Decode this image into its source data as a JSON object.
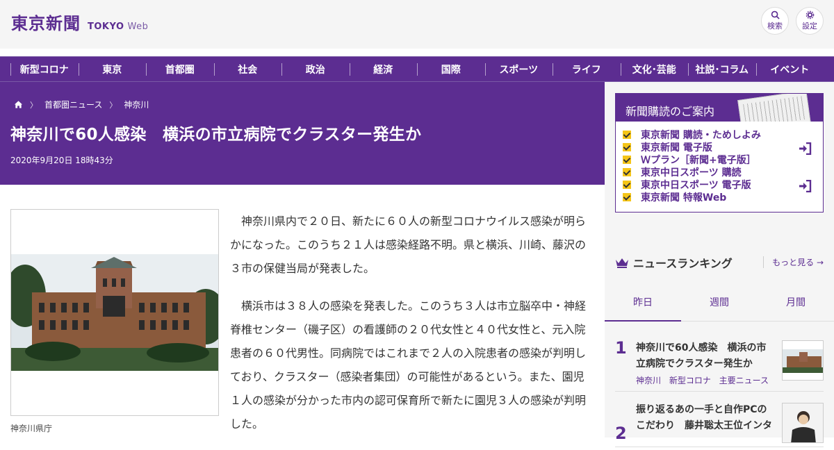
{
  "header": {
    "logo_kanji": "東京新聞",
    "logo_en": "TOKYO",
    "logo_web": "Web",
    "search_label": "検索",
    "settings_label": "設定"
  },
  "nav": [
    "新型コロナ",
    "東京",
    "首都圏",
    "社会",
    "政治",
    "経済",
    "国際",
    "スポーツ",
    "ライフ",
    "文化･芸能",
    "社説･コラム",
    "イベント"
  ],
  "article": {
    "breadcrumb": [
      "首都圏ニュース",
      "神奈川"
    ],
    "title": "神奈川で60人感染　横浜の市立病院でクラスター発生か",
    "date": "2020年9月20日 18時43分",
    "caption": "神奈川県庁",
    "paragraphs": [
      "神奈川県内で２０日、新たに６０人の新型コロナウイルス感染が明らかになった。このうち２１人は感染経路不明。県と横浜、川崎、藤沢の３市の保健当局が発表した。",
      "横浜市は３８人の感染を発表した。このうち３人は市立脳卒中・神経脊椎センター（磯子区）の看護師の２０代女性と４０代女性と、元入院患者の６０代男性。同病院ではこれまで２人の入院患者の感染が判明しており、クラスター（感染者集団）の可能性があるという。また、園児１人の感染が分かった市内の認可保育所で新たに園児３人の感染が判明した。"
    ]
  },
  "sidebar": {
    "subscription": {
      "heading": "新聞購読のご案内",
      "items": [
        "東京新聞 購読・ためしよみ",
        "東京新聞 電子版",
        "Ｗプラン［新聞+電子版］",
        "東京中日スポーツ 購読",
        "東京中日スポーツ 電子版",
        "東京新聞 特報Web"
      ]
    },
    "ranking": {
      "title": "ニュースランキング",
      "more": "もっと見る",
      "tabs": [
        "昨日",
        "週間",
        "月間"
      ],
      "items": [
        {
          "rank": "1",
          "title": "神奈川で60人感染　横浜の市立病院でクラスター発生か",
          "tags": "神奈川 新型コロナ 主要ニュース"
        },
        {
          "rank": "2",
          "title": "振り返るあの一手と自作PCのこだわり　藤井聡太王位インタ",
          "tags": ""
        }
      ]
    }
  },
  "colors": {
    "brand": "#5c2d91",
    "accent": "#f5c518"
  }
}
